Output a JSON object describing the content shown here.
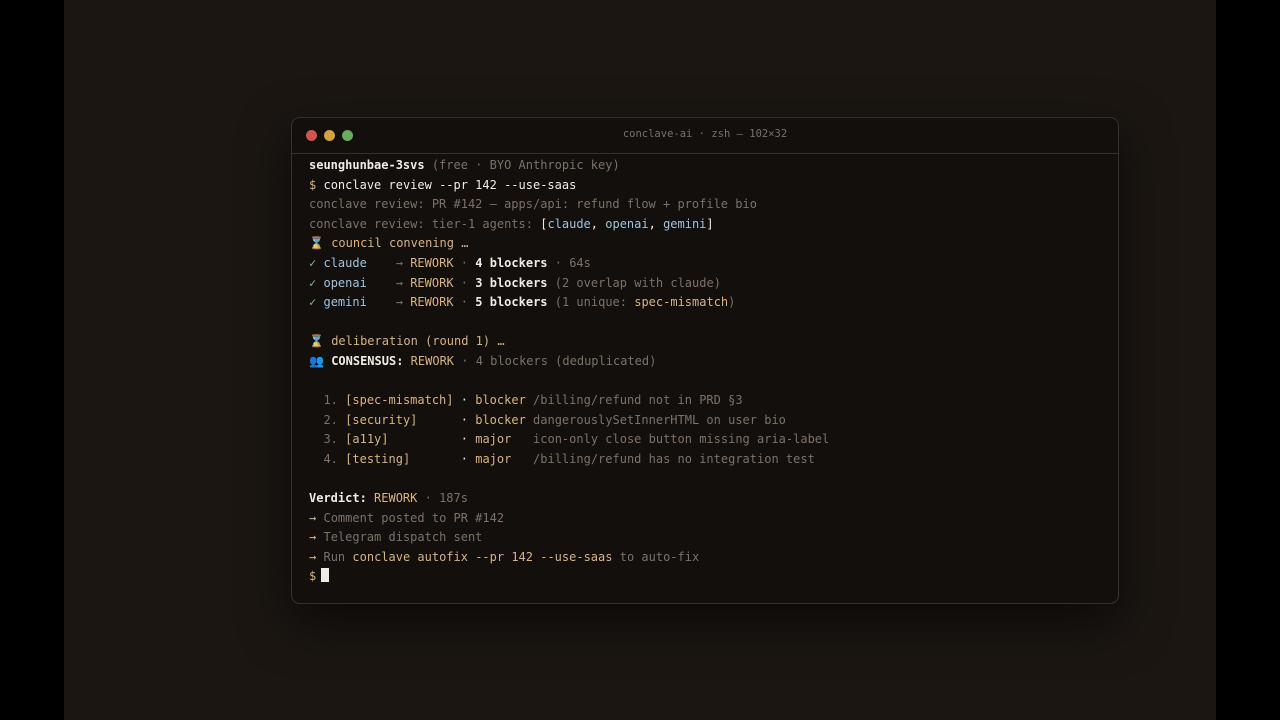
{
  "window": {
    "title": "conclave-ai · zsh — 102×32"
  },
  "terminal": {
    "user": "seunghunbae-3svs",
    "user_note": "(free · BYO Anthropic key)",
    "prompt": "$",
    "command": "conclave review --pr 142 --use-saas",
    "review_line": "conclave review: PR #142 — apps/api: refund flow + profile bio",
    "tier_prefix": "conclave review: tier-1 agents:",
    "tier_agents_open": "[",
    "tier_agents": [
      "claude",
      "openai",
      "gemini"
    ],
    "tier_agents_sep": ", ",
    "tier_agents_close": "]",
    "convening_icon": "⌛",
    "convening": "council convening …",
    "agents": [
      {
        "check": "✓",
        "name": "claude",
        "arrow": "→",
        "verdict": "REWORK",
        "sep": "·",
        "blockers": "4 blockers",
        "note": "· 64s",
        "note_strong": "",
        "note_end": ""
      },
      {
        "check": "✓",
        "name": "openai",
        "arrow": "→",
        "verdict": "REWORK",
        "sep": "·",
        "blockers": "3 blockers",
        "note": "(2 overlap with claude)",
        "note_strong": "",
        "note_end": ""
      },
      {
        "check": "✓",
        "name": "gemini",
        "arrow": "→",
        "verdict": "REWORK",
        "sep": "·",
        "blockers": "5 blockers",
        "note": "(1 unique: ",
        "note_strong": "spec-mismatch",
        "note_end": ")"
      }
    ],
    "deliberation_icon": "⌛",
    "deliberation": "deliberation (round 1) …",
    "consensus_icon": "👥",
    "consensus_label": "CONSENSUS:",
    "consensus_verdict": "REWORK",
    "consensus_note": "· 4 blockers (deduplicated)",
    "issues": [
      {
        "num": "1.",
        "tag": "[spec-mismatch]",
        "sep": "·",
        "severity": "blocker",
        "desc": "/billing/refund not in PRD §3"
      },
      {
        "num": "2.",
        "tag": "[security]",
        "sep": "·",
        "severity": "blocker",
        "desc": "dangerouslySetInnerHTML on user bio"
      },
      {
        "num": "3.",
        "tag": "[a11y]",
        "sep": "·",
        "severity": "major",
        "desc": "icon-only close button missing aria-label"
      },
      {
        "num": "4.",
        "tag": "[testing]",
        "sep": "·",
        "severity": "major",
        "desc": "/billing/refund has no integration test"
      }
    ],
    "verdict_label": "Verdict:",
    "verdict_value": "REWORK",
    "verdict_time": "· 187s",
    "actions": [
      {
        "arrow": "→",
        "text": "Comment posted to PR #142"
      },
      {
        "arrow": "→",
        "text": "Telegram dispatch sent"
      }
    ],
    "run_arrow": "→",
    "run_prefix": "Run",
    "run_command": "conclave autofix --pr 142 --use-saas",
    "run_suffix": "to auto-fix",
    "final_prompt": "$"
  },
  "colors": {
    "background": "#1b1612",
    "terminal": "#120f0c",
    "accent": "#d8b380",
    "success": "#7fbf86",
    "agent": "#9ec4e0"
  }
}
